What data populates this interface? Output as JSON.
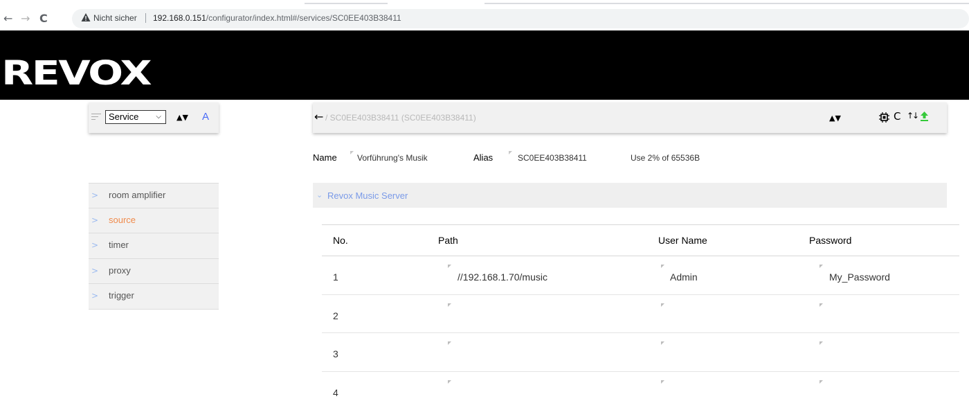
{
  "browser": {
    "back": "←",
    "forward": "→",
    "reload": "C",
    "security_label": "Nicht sicher",
    "url_host": "192.168.0.151",
    "url_path": "/configurator/index.html#/services/SC0EE403B38411"
  },
  "header": {
    "logo_text": "REVOX"
  },
  "filter": {
    "select_value": "Service",
    "sort_glyph": "▲▼",
    "alpha_glyph": "A"
  },
  "sidebar": {
    "items": [
      {
        "label": "room amplifier",
        "active": false
      },
      {
        "label": "source",
        "active": true
      },
      {
        "label": "timer",
        "active": false
      },
      {
        "label": "proxy",
        "active": false
      },
      {
        "label": "trigger",
        "active": false
      }
    ]
  },
  "toolbar": {
    "back": "←",
    "breadcrumb": "/ SC0EE403B38411 (SC0EE403B38411)",
    "sort_glyph": "▲▼",
    "reload_glyph": "C",
    "swap_glyph": "↑↓"
  },
  "service": {
    "name_label": "Name",
    "name_value": "Vorführung's Musik",
    "alias_label": "Alias",
    "alias_value": "SC0EE403B38411",
    "usage": "Use 2% of 65536B"
  },
  "section": {
    "title": "Revox Music Server",
    "chevron": "⌄"
  },
  "table": {
    "headers": {
      "no": "No.",
      "path": "Path",
      "user": "User Name",
      "password": "Password"
    },
    "rows": [
      {
        "no": "1",
        "path": "//192.168.1.70/music",
        "user": "Admin",
        "password": "My_Password"
      },
      {
        "no": "2",
        "path": "",
        "user": "",
        "password": ""
      },
      {
        "no": "3",
        "path": "",
        "user": "",
        "password": ""
      },
      {
        "no": "4",
        "path": "",
        "user": "",
        "password": ""
      }
    ]
  },
  "colors": {
    "accent_blue": "#7a9ae8",
    "active_orange": "#f08a4b",
    "upload_green": "#35c93a",
    "header_black": "#000000"
  }
}
